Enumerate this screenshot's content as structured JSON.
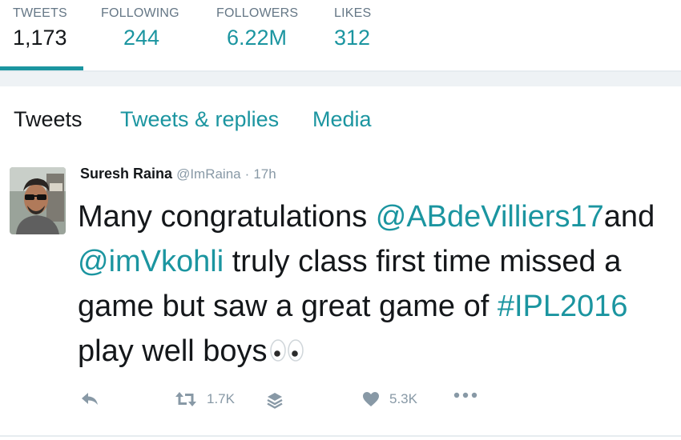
{
  "stats": [
    {
      "label": "TWEETS",
      "value": "1,173"
    },
    {
      "label": "FOLLOWING",
      "value": "244"
    },
    {
      "label": "FOLLOWERS",
      "value": "6.22M"
    },
    {
      "label": "LIKES",
      "value": "312"
    }
  ],
  "tabs": [
    "Tweets",
    "Tweets & replies",
    "Media"
  ],
  "tweet": {
    "fullname": "Suresh Raina",
    "handle": "@ImRaina",
    "separator": "·",
    "time": "17h",
    "text": {
      "p1": "Many congratulations ",
      "mention1": "@ABdeVilliers17",
      "p2": "and",
      "mention2": "@imVkohli",
      "p3": " truly class first time missed a game but saw a great game of ",
      "hashtag": "#IPL2016",
      "p4": " play well boys"
    },
    "emoji": "eyes-emoji",
    "actions": {
      "reply_icon": "reply-icon",
      "retweet_icon": "retweet-icon",
      "retweet_count": "1.7K",
      "layers_icon": "layers-icon",
      "like_icon": "heart-icon",
      "like_count": "5.3K",
      "more_icon": "more-icon"
    }
  },
  "colors": {
    "accent": "#1b95a0",
    "muted": "#8899a6",
    "text": "#14171a",
    "divider": "#e6ecf0"
  }
}
